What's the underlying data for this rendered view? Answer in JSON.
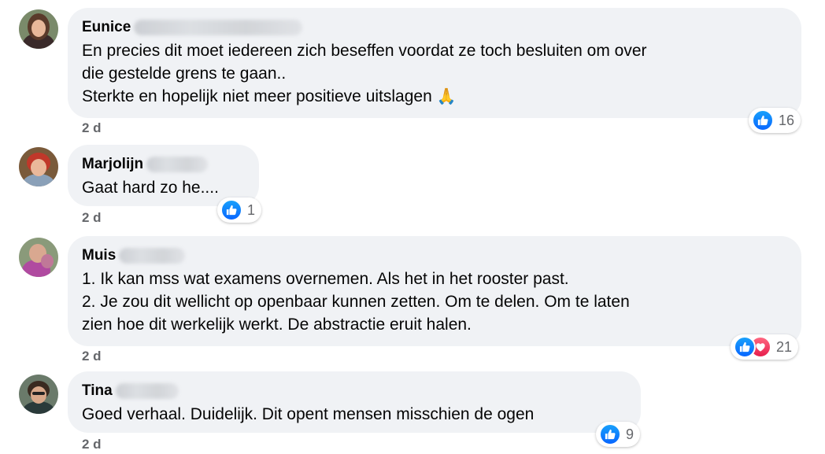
{
  "comments": [
    {
      "author": "Eunice",
      "lines": "En precies dit moet iedereen zich beseffen voordat ze toch besluiten om over\ndie gestelde grens te gaan..\nSterkte en hopelijk niet meer positieve uitslagen",
      "emoji": "🙏",
      "time": "2 d",
      "reaction_count": "16",
      "avatar_color": "#6b4a3a"
    },
    {
      "author": "Marjolijn",
      "lines": "Gaat hard zo he....",
      "time": "2 d",
      "reaction_count": "1",
      "avatar_color": "#b8453a"
    },
    {
      "author": "Muis",
      "lines": "1. Ik kan mss wat examens overnemen. Als het in het rooster past.\n2. Je zou dit wellicht op openbaar kunnen zetten. Om te delen. Om te laten\nzien hoe dit werkelijk werkt. De abstractie eruit halen.",
      "time": "2 d",
      "reaction_count": "21",
      "avatar_color": "#9a5a8a"
    },
    {
      "author": "Tina",
      "lines": "Goed verhaal. Duidelijk. Dit opent mensen misschien de ogen",
      "time": "2 d",
      "reaction_count": "9",
      "avatar_color": "#4a4a44"
    }
  ],
  "colors": {
    "like": "#0866ff",
    "love": "#e61e4d",
    "bubble": "#f0f2f5",
    "meta": "#65676b"
  },
  "icons": {
    "like": "thumbs-up-icon",
    "love": "heart-icon",
    "emoji": "folded-hands-emoji"
  }
}
